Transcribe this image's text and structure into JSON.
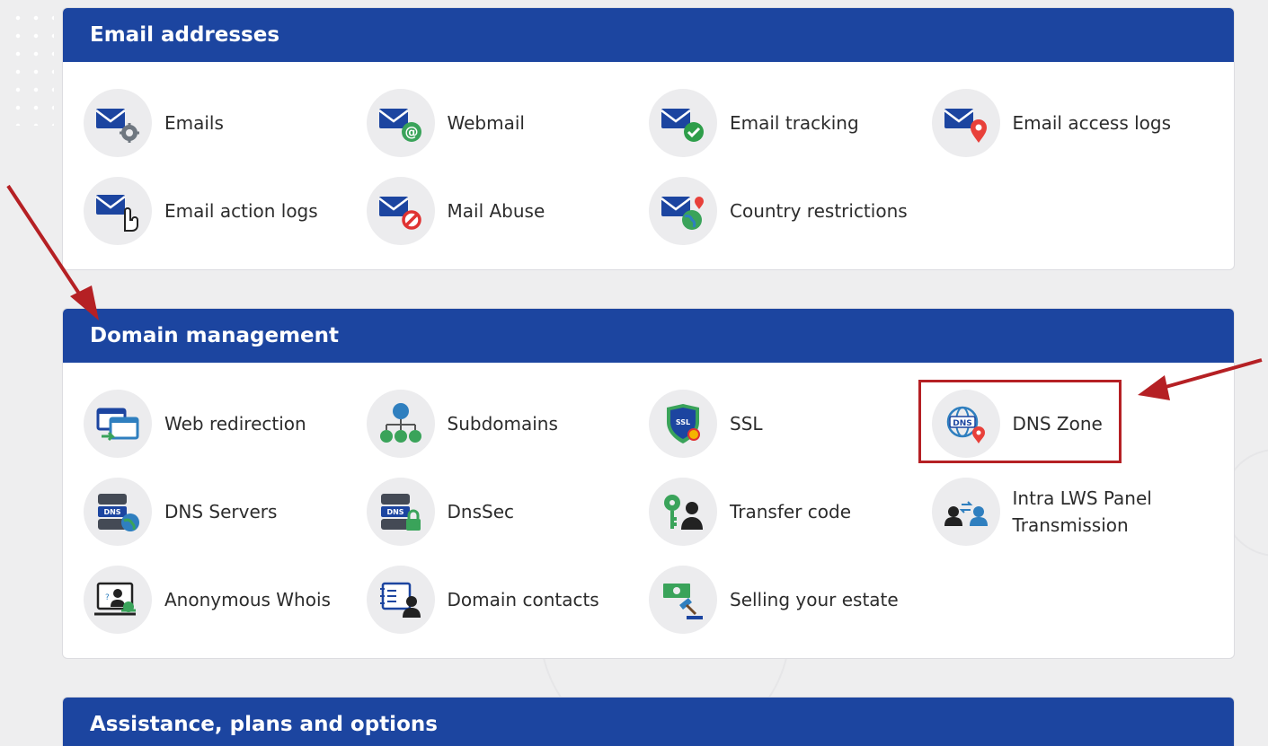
{
  "sections": [
    {
      "title": "Email addresses",
      "items": [
        {
          "label": "Emails",
          "icon": "email-settings-icon"
        },
        {
          "label": "Webmail",
          "icon": "webmail-icon"
        },
        {
          "label": "Email tracking",
          "icon": "email-tracking-icon"
        },
        {
          "label": "Email access logs",
          "icon": "email-access-logs-icon"
        },
        {
          "label": "Email action logs",
          "icon": "email-action-logs-icon"
        },
        {
          "label": "Mail Abuse",
          "icon": "mail-abuse-icon"
        },
        {
          "label": "Country restrictions",
          "icon": "country-restrictions-icon"
        }
      ]
    },
    {
      "title": "Domain management",
      "items": [
        {
          "label": "Web redirection",
          "icon": "web-redirection-icon"
        },
        {
          "label": "Subdomains",
          "icon": "subdomains-icon"
        },
        {
          "label": "SSL",
          "icon": "ssl-shield-icon"
        },
        {
          "label": "DNS Zone",
          "icon": "dns-zone-icon"
        },
        {
          "label": "DNS Servers",
          "icon": "dns-servers-icon"
        },
        {
          "label": "DnsSec",
          "icon": "dnssec-icon"
        },
        {
          "label": "Transfer code",
          "icon": "transfer-code-icon"
        },
        {
          "label": "Intra LWS Panel Transmission",
          "icon": "intra-transmission-icon"
        },
        {
          "label": "Anonymous Whois",
          "icon": "anonymous-whois-icon"
        },
        {
          "label": "Domain contacts",
          "icon": "domain-contacts-icon"
        },
        {
          "label": "Selling your estate",
          "icon": "selling-estate-icon"
        }
      ]
    },
    {
      "title": "Assistance, plans and options",
      "items": []
    }
  ],
  "colors": {
    "header": "#1c45a0",
    "highlight": "#b52024",
    "arrow": "#b52024"
  }
}
